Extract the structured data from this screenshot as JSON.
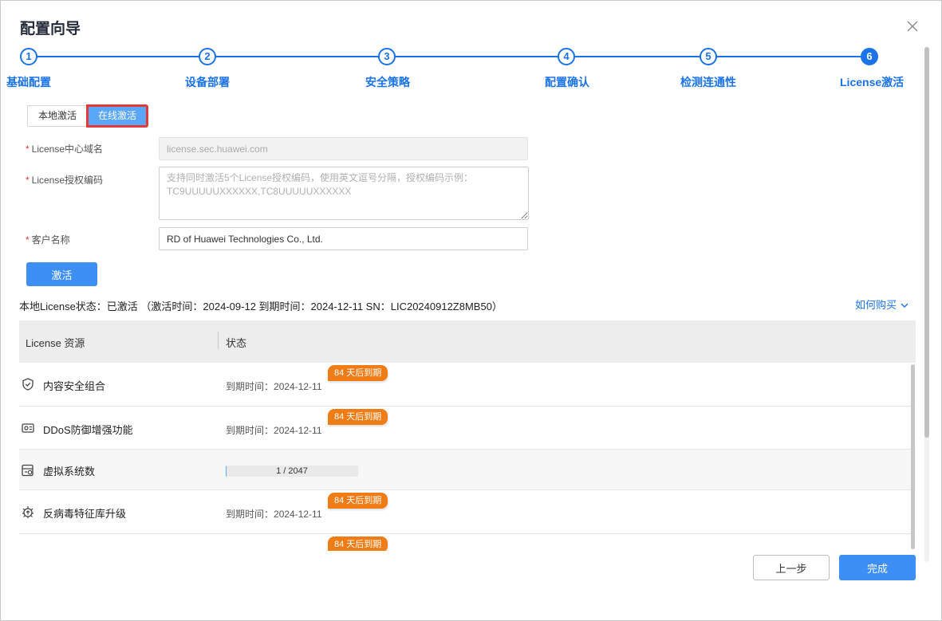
{
  "dialog": {
    "title": "配置向导",
    "close_icon": "close-icon"
  },
  "steps": [
    {
      "number": "1",
      "label": "基础配置",
      "state": "done"
    },
    {
      "number": "2",
      "label": "设备部署",
      "state": "done"
    },
    {
      "number": "3",
      "label": "安全策略",
      "state": "done"
    },
    {
      "number": "4",
      "label": "配置确认",
      "state": "done"
    },
    {
      "number": "5",
      "label": "检测连通性",
      "state": "done"
    },
    {
      "number": "6",
      "label": "License激活",
      "state": "active"
    }
  ],
  "activation_tabs": {
    "local": "本地激活",
    "online": "在线激活",
    "selected": "online"
  },
  "form": {
    "domain": {
      "label": "License中心域名",
      "required": "*",
      "value": "license.sec.huawei.com"
    },
    "auth_code": {
      "label": "License授权编码",
      "required": "*",
      "placeholder": "支持同时激活5个License授权编码，使用英文逗号分隔，授权编码示例：TC9UUUUUXXXXXX,TC8UUUUUXXXXXX",
      "value": ""
    },
    "customer": {
      "label": "客户名称",
      "required": "*",
      "value": "RD of Huawei Technologies Co., Ltd."
    },
    "activate_button": "激活"
  },
  "status": {
    "text": "本地License状态：已激活 （激活时间：2024-09-12 到期时间：2024-12-11 SN：LIC20240912Z8MB50）",
    "how_to_buy": "如何购买",
    "how_to_buy_icon": "chevron-down-icon"
  },
  "table": {
    "headers": {
      "resource": "License 资源",
      "status": "状态"
    },
    "rows": [
      {
        "icon": "shield-check-icon",
        "name": "内容安全组合",
        "type": "expiry",
        "expiry_label": "到期时间：",
        "expiry_date": "2024-12-11",
        "badge": "84 天后到期"
      },
      {
        "icon": "ddos-icon",
        "name": "DDoS防御增强功能",
        "type": "expiry",
        "expiry_label": "到期时间：",
        "expiry_date": "2024-12-11",
        "badge": "84 天后到期"
      },
      {
        "icon": "virtual-system-icon",
        "name": "虚拟系统数",
        "type": "progress",
        "progress_text": "1 / 2047",
        "progress_fraction": 0.0005
      },
      {
        "icon": "virus-upgrade-icon",
        "name": "反病毒特征库升级",
        "type": "expiry",
        "expiry_label": "到期时间：",
        "expiry_date": "2024-12-11",
        "badge": "84 天后到期"
      },
      {
        "icon": "",
        "name": "",
        "type": "partial",
        "badge": "84 天后到期"
      }
    ]
  },
  "footer": {
    "prev": "上一步",
    "finish": "完成"
  },
  "colors": {
    "accent": "#1a73e8",
    "primary_button": "#3d8ff5",
    "badge": "#f07c15",
    "highlight_box": "#e53935"
  }
}
